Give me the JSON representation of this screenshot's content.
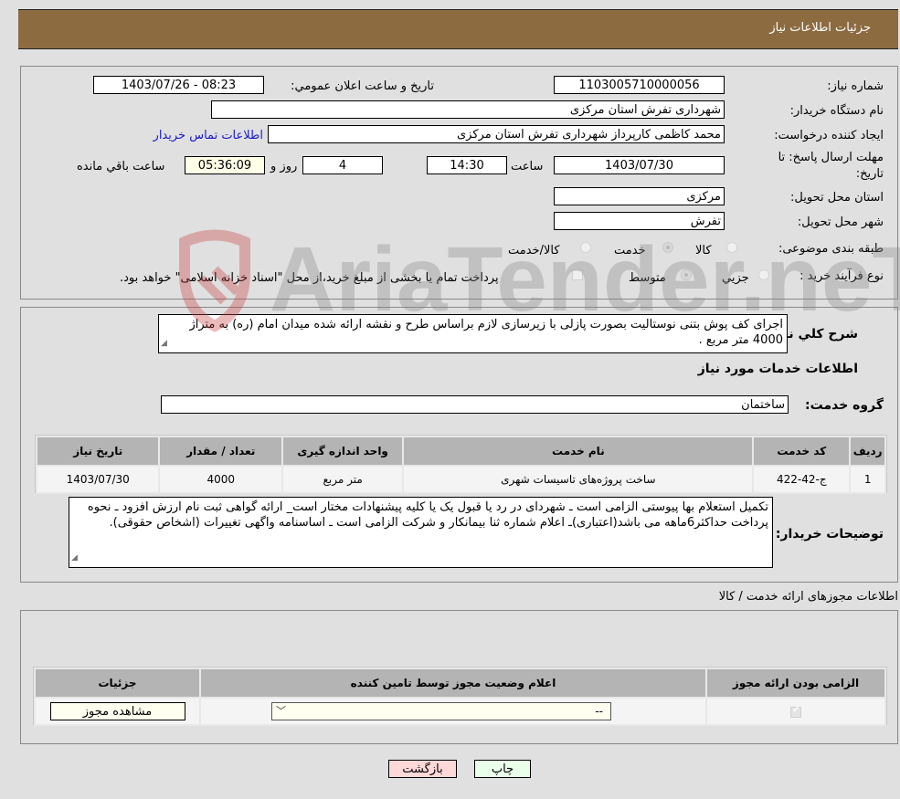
{
  "header": {
    "title": "جزئیات اطلاعات نیاز"
  },
  "form": {
    "need_number": {
      "label": "شماره نیاز:",
      "value": "1103005710000056"
    },
    "announce_datetime": {
      "label": "تاریخ و ساعت اعلان عمومي:",
      "value": "1403/07/26 - 08:23"
    },
    "buyer_org": {
      "label": "نام دستگاه خریدار:",
      "value": "شهرداری تفرش استان مرکزی"
    },
    "requester": {
      "label": "ایجاد کننده درخواست:",
      "value": "محمد کاظمی کارپرداز شهرداری تفرش استان مرکزی"
    },
    "buyer_contact_link": "اطلاعات تماس خریدار",
    "deadline": {
      "label": "مهلت ارسال پاسخ: تا تاریخ:",
      "date": "1403/07/30",
      "time_label": "ساعت",
      "time": "14:30",
      "days": "4",
      "days_label": "روز و",
      "remaining": "05:36:09",
      "remaining_label": "ساعت باقي مانده"
    },
    "delivery_province": {
      "label": "استان محل تحویل:",
      "value": "مرکزی"
    },
    "delivery_city": {
      "label": "شهر محل تحویل:",
      "value": "تفرش"
    },
    "category": {
      "label": "طبقه بندی موضوعی:",
      "options": [
        {
          "label": "کالا",
          "selected": false
        },
        {
          "label": "خدمت",
          "selected": true
        },
        {
          "label": "کالا/خدمت",
          "selected": false
        }
      ]
    },
    "purchase_type": {
      "label": "نوع فرآیند خرید :",
      "options": [
        {
          "label": "جزيي",
          "selected": false
        },
        {
          "label": "متوسط",
          "selected": true
        }
      ],
      "treasury_checkbox_label": "پرداخت تمام یا بخشی از مبلغ خرید،از محل \"اسناد خزانه اسلامی\" خواهد بود.",
      "treasury_checked": false
    }
  },
  "description": {
    "label": "شرح کلي نیاز:",
    "value": "اجرای کف پوش بتنی نوستالیت بصورت پازلی با زیرسازی لازم براساس طرح و نقشه ارائه شده میدان امام (ره) به متراژ 4000 متر مربع ."
  },
  "services_section": {
    "title": "اطلاعات خدمات مورد نیاز",
    "group_label": "گروه خدمت:",
    "group_value": "ساختمان",
    "table": {
      "headers": [
        "ردیف",
        "کد خدمت",
        "نام خدمت",
        "واحد اندازه گیری",
        "تعداد / مقدار",
        "تاریخ نیاز"
      ],
      "rows": [
        [
          "1",
          "ج-42-422",
          "ساخت پروژه‌های تاسیسات شهری",
          "متر مربع",
          "4000",
          "1403/07/30"
        ]
      ]
    }
  },
  "buyer_notes": {
    "label": "توضیحات خریدار:",
    "value": "تکمیل استعلام بها پیوستی الزامی است ـ شهردای در رد یا قبول یک یا کلیه پیشنهادات مختار است_ ارائه گواهی ثبت نام ارزش افزود ـ نحوه پرداخت حداکثر6ماهه می باشد(اعتباری)ـ اعلام شماره ثنا بیمانکار و شرکت الزامی است ـ اساسنامه واگهی تغییرات (اشخاص حقوقی)."
  },
  "permits": {
    "title": "اطلاعات مجوزهای ارائه خدمت / کالا",
    "headers": [
      "الزامی بودن ارائه مجوز",
      "اعلام وضعیت مجوز توسط تامین کننده",
      "جزئیات"
    ],
    "row": {
      "required_checked": true,
      "status_value": "--",
      "details_button": "مشاهده مجوز"
    }
  },
  "buttons": {
    "print": "چاپ",
    "back": "بازگشت"
  },
  "watermark": {
    "text": "AriaTender.neT"
  }
}
